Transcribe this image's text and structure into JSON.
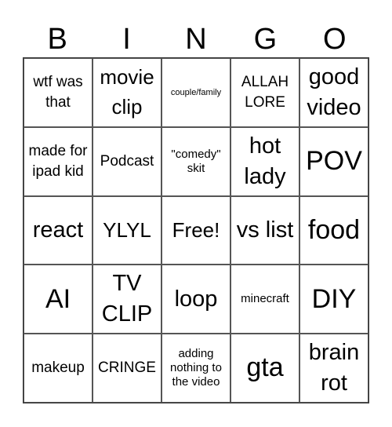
{
  "header": {
    "letters": [
      "B",
      "I",
      "N",
      "G",
      "O"
    ]
  },
  "cells": [
    [
      "wtf was that",
      "movie clip",
      "couple/family",
      "ALLAH LORE",
      "good video"
    ],
    [
      "made for ipad kid",
      "Podcast",
      "\"comedy\" skit",
      "hot lady",
      "POV"
    ],
    [
      "react",
      "YLYL",
      "Free!",
      "vs list",
      "food"
    ],
    [
      "AI",
      "TV CLIP",
      "loop",
      "minecraft",
      "DIY"
    ],
    [
      "makeup",
      "CRINGE",
      "adding nothing to the video",
      "gta",
      "brain rot"
    ]
  ]
}
